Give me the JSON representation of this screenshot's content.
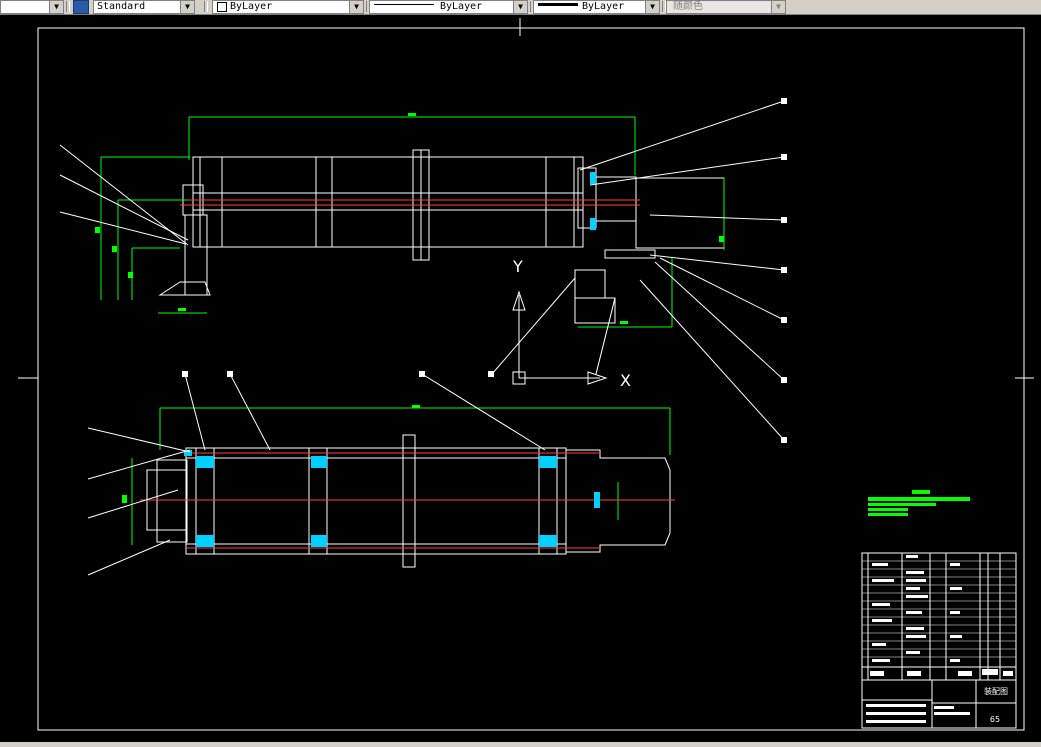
{
  "toolbar": {
    "text_style": "Standard",
    "layer_color": "ByLayer",
    "linetype": "ByLayer",
    "lineweight": "ByLayer",
    "plot_style": "随颜色"
  },
  "drawing": {
    "view_axis_y": "Y",
    "view_axis_x": "X",
    "title_block_name": "装配图",
    "sheet_number": "65"
  }
}
